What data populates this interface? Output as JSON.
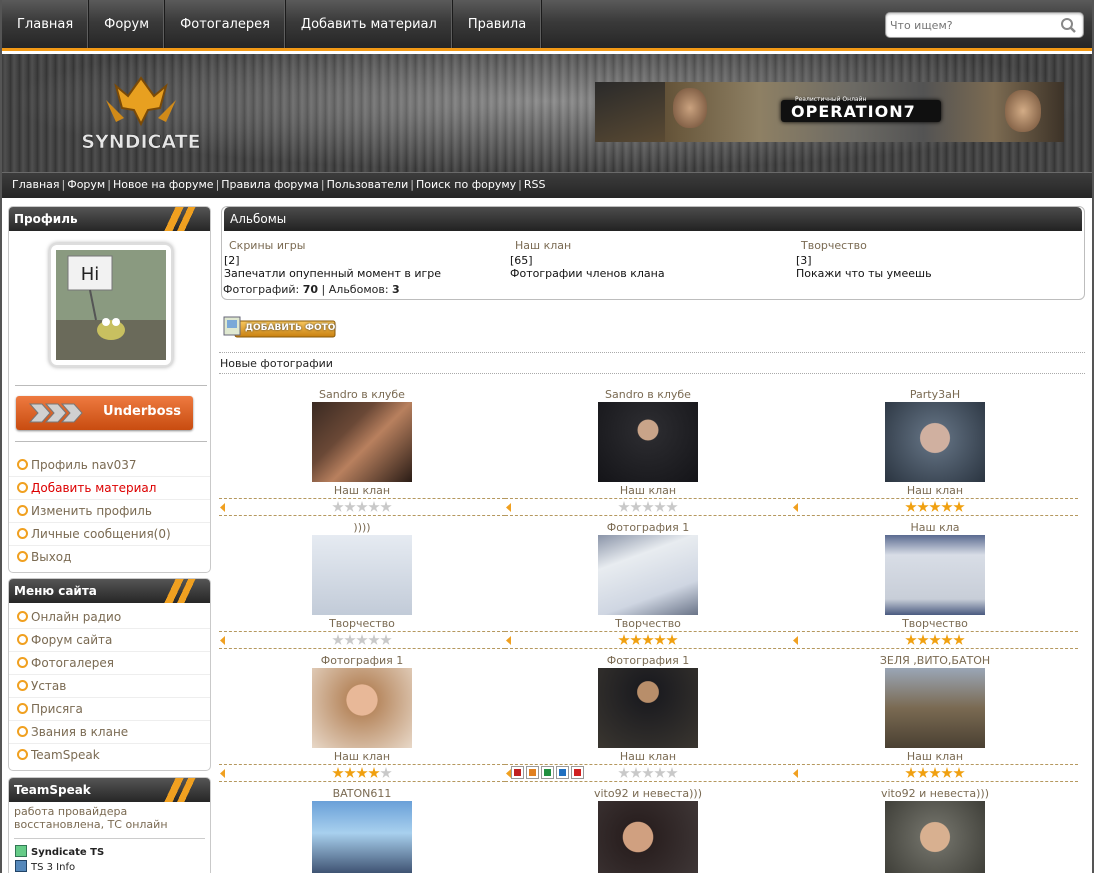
{
  "topnav": {
    "items": [
      "Главная",
      "Форум",
      "Фотогалерея",
      "Добавить материал",
      "Правила"
    ],
    "search_placeholder": "Что ищем?"
  },
  "header": {
    "logo_text": "SYNDICATE",
    "banner_title": "OPERATION7",
    "banner_sub": "Реалистичный Онлайн"
  },
  "subnav": {
    "links": [
      "Главная",
      "Форум",
      "Новое на форуме",
      "Правила форума",
      "Пользователи",
      "Поиск по форуму",
      "RSS"
    ]
  },
  "profile": {
    "title": "Профиль",
    "avatar_text": "Hi",
    "rank": "Underboss",
    "items": [
      "Профиль nav037",
      "Добавить материал",
      "Изменить профиль",
      "Личные сообщения(0)",
      "Выход"
    ]
  },
  "site_menu": {
    "title": "Меню сайта",
    "items": [
      "Онлайн радио",
      "Форум сайта",
      "Фотогалерея",
      "Устав",
      "Присяга",
      "Звания в клане",
      "TeamSpeak"
    ]
  },
  "teamspeak": {
    "title": "TeamSpeak",
    "message": "работа провайдера восстановлена, ТС онлайн",
    "server": "Syndicate TS",
    "info": "TS 3 Info"
  },
  "albums": {
    "title": "Альбомы",
    "list": [
      {
        "name": "Скрины игры",
        "count": "[2]",
        "desc": "Запечатли опупенный момент в игре"
      },
      {
        "name": "Наш клан",
        "count": "[65]",
        "desc": "Фотографии членов клана"
      },
      {
        "name": "Творчество",
        "count": "[3]",
        "desc": "Покажи что ты умеешь"
      }
    ],
    "photos_label": "Фотографий:",
    "photos_count": "70",
    "albums_label": "Альбомов:",
    "albums_count": "3"
  },
  "add_photo_label": "ДОБАВИТЬ ФОТО",
  "new_photos_label": "Новые фотографии",
  "photos": [
    {
      "title": "Sandro в клубе",
      "album": "Наш клан",
      "rating": 0
    },
    {
      "title": "Sandro в клубе",
      "album": "Наш клан",
      "rating": 0
    },
    {
      "title": "Party3aH",
      "album": "Наш клан",
      "rating": 5
    },
    {
      "title": "))))",
      "album": "Творчество",
      "rating": 0
    },
    {
      "title": "Фотография 1",
      "album": "Творчество",
      "rating": 5
    },
    {
      "title": "Наш кла",
      "album": "Творчество",
      "rating": 5
    },
    {
      "title": "Фотография 1",
      "album": "Наш клан",
      "rating": 4
    },
    {
      "title": "Фотография 1",
      "album": "Наш клан",
      "rating": 0
    },
    {
      "title": "ЗЕЛЯ ,ВИТО,БАТОН",
      "album": "Наш клан",
      "rating": 5
    },
    {
      "title": "BATON611",
      "album": "",
      "rating": 0
    },
    {
      "title": "vito92 и невеста)))",
      "album": "",
      "rating": 0
    },
    {
      "title": "vito92 и невеста)))",
      "album": "",
      "rating": 0
    }
  ],
  "colors": {
    "accent": "#f39a16",
    "link": "#7a6a52",
    "header_dark": "#262626"
  }
}
